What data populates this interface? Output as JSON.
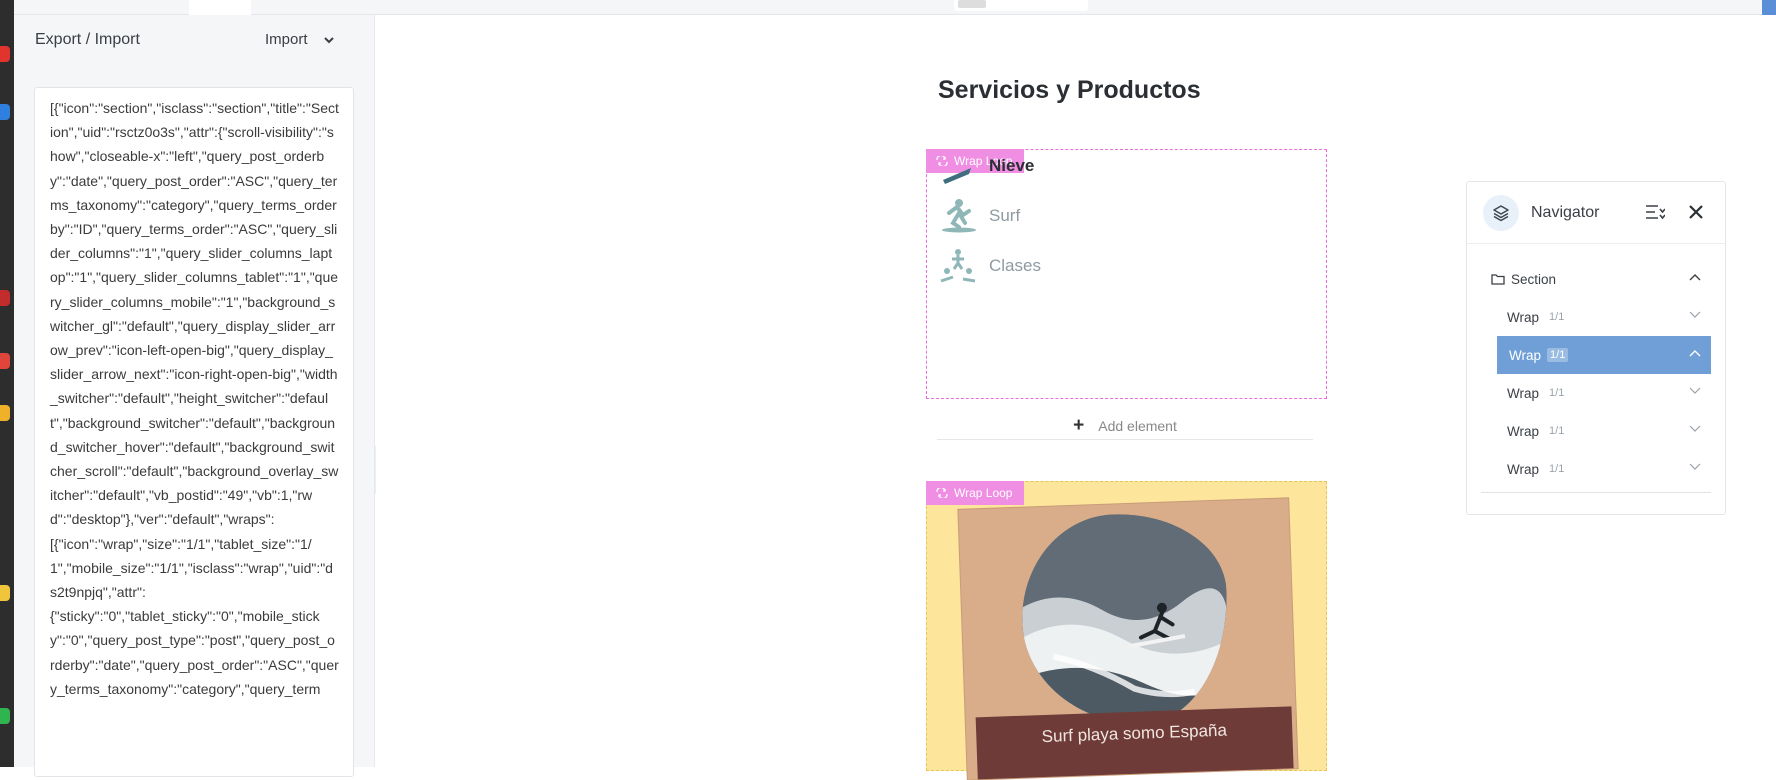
{
  "left_panel": {
    "title": "Export / Import",
    "mode": "Import",
    "code": "[{\"icon\":\"section\",\"isclass\":\"section\",\"title\":\"Section\",\"uid\":\"rsctz0o3s\",\"attr\":{\"scroll-visibility\":\"show\",\"closeable-x\":\"left\",\"query_post_orderby\":\"date\",\"query_post_order\":\"ASC\",\"query_terms_taxonomy\":\"category\",\"query_terms_orderby\":\"ID\",\"query_terms_order\":\"ASC\",\"query_slider_columns\":\"1\",\"query_slider_columns_laptop\":\"1\",\"query_slider_columns_tablet\":\"1\",\"query_slider_columns_mobile\":\"1\",\"background_switcher_gl\":\"default\",\"query_display_slider_arrow_prev\":\"icon-left-open-big\",\"query_display_slider_arrow_next\":\"icon-right-open-big\",\"width_switcher\":\"default\",\"height_switcher\":\"default\",\"background_switcher\":\"default\",\"background_switcher_hover\":\"default\",\"background_switcher_scroll\":\"default\",\"background_overlay_switcher\":\"default\",\"vb_postid\":\"49\",\"vb\":1,\"rwd\":\"desktop\"},\"ver\":\"default\",\"wraps\":\n[{\"icon\":\"wrap\",\"size\":\"1/1\",\"tablet_size\":\"1/1\",\"mobile_size\":\"1/1\",\"isclass\":\"wrap\",\"uid\":\"ds2t9npjq\",\"attr\":\n{\"sticky\":\"0\",\"tablet_sticky\":\"0\",\"mobile_sticky\":\"0\",\"query_post_type\":\"post\",\"query_post_orderby\":\"date\",\"query_post_order\":\"ASC\",\"query_terms_taxonomy\":\"category\",\"query_term"
  },
  "canvas": {
    "page_title": "Servicios y Productos",
    "wrap_loop_label": "Wrap Loop",
    "items": [
      {
        "label": "Nieve",
        "icon": "snowboard-icon"
      },
      {
        "label": "Surf",
        "icon": "surfer-icon"
      },
      {
        "label": "Clases",
        "icon": "surf-class-icon"
      }
    ],
    "add_element": "Add element",
    "card_caption": "Surf playa somo España"
  },
  "navigator": {
    "title": "Navigator",
    "section_label": "Section",
    "rows": [
      {
        "label": "Wrap",
        "size": "1/1",
        "selected": false
      },
      {
        "label": "Wrap",
        "size": "1/1",
        "selected": true
      },
      {
        "label": "Wrap",
        "size": "1/1",
        "selected": false
      },
      {
        "label": "Wrap",
        "size": "1/1",
        "selected": false
      },
      {
        "label": "Wrap",
        "size": "1/1",
        "selected": false
      }
    ]
  },
  "colors": {
    "wrap_border": "#e86fd9",
    "wrap_badge": "#ef8ee3",
    "selected_row": "#6f9fd6",
    "card_bg": "#fde59c",
    "caption_bg": "#6e3b39"
  }
}
